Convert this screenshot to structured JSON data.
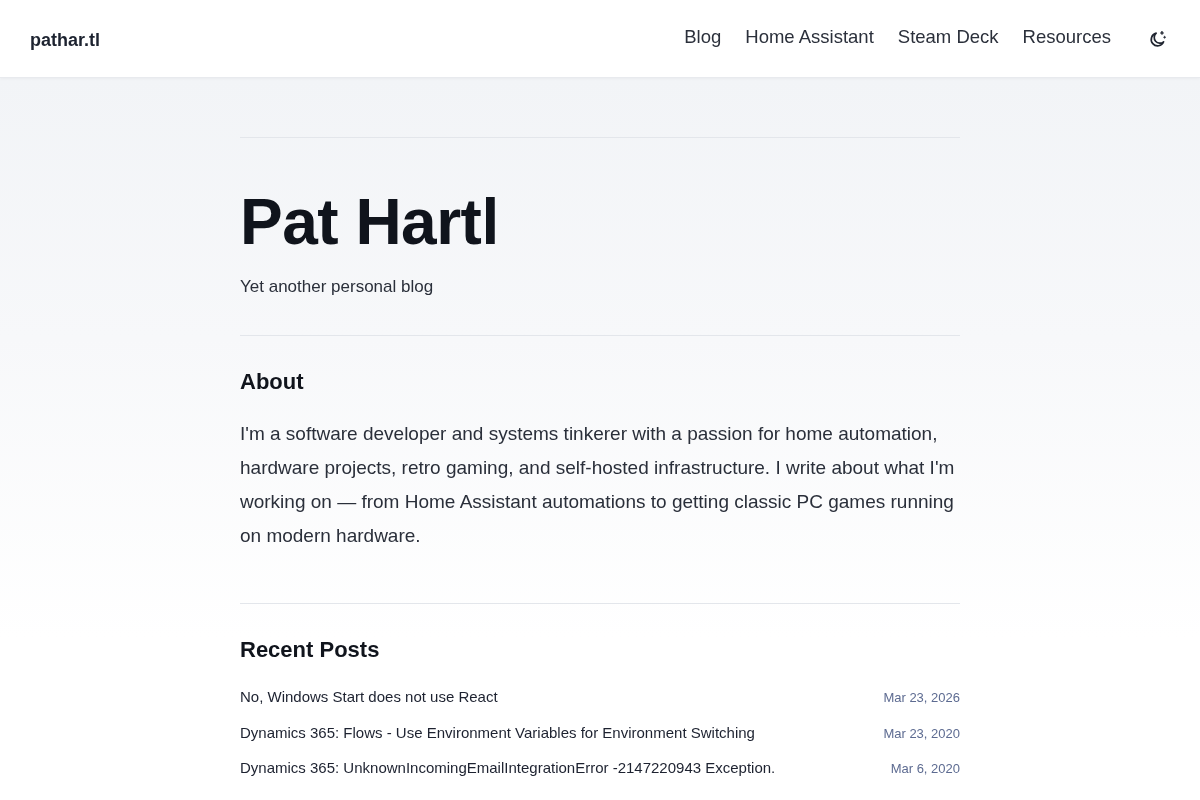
{
  "header": {
    "site_title": "pathar.tl",
    "nav": [
      {
        "label": "Blog"
      },
      {
        "label": "Home Assistant"
      },
      {
        "label": "Steam Deck"
      },
      {
        "label": "Resources"
      }
    ]
  },
  "hero": {
    "title": "Pat Hartl",
    "subtitle": "Yet another personal blog"
  },
  "about": {
    "heading": "About",
    "text": "I'm a software developer and systems tinkerer with a passion for home automation, hardware projects, retro gaming, and self-hosted infrastructure. I write about what I'm working on — from Home Assistant automations to getting classic PC games running on modern hardware."
  },
  "recent_posts": {
    "heading": "Recent Posts",
    "posts": [
      {
        "title": "No, Windows Start does not use React",
        "date": "Mar 23, 2026"
      },
      {
        "title": "Dynamics 365: Flows - Use Environment Variables for Environment Switching",
        "date": "Mar 23, 2020"
      },
      {
        "title": "Dynamics 365: UnknownIncomingEmailIntegrationError -2147220943 Exception.",
        "date": "Mar 6, 2020"
      }
    ]
  }
}
